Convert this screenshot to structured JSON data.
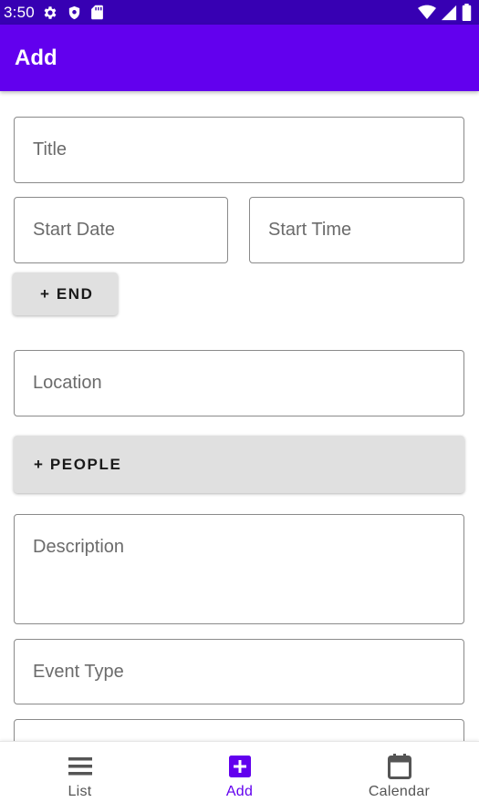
{
  "status_bar": {
    "time": "3:50",
    "left_icons": [
      "gear-icon",
      "shield-icon",
      "sd-card-icon"
    ],
    "right_icons": [
      "wifi-icon",
      "cell-signal-icon",
      "battery-icon"
    ]
  },
  "app_bar": {
    "title": "Add"
  },
  "form": {
    "title_placeholder": "Title",
    "start_date_placeholder": "Start Date",
    "start_time_placeholder": "Start Time",
    "end_button_label": "+ END",
    "location_placeholder": "Location",
    "people_button_label": "+ PEOPLE",
    "description_placeholder": "Description",
    "event_type_placeholder": "Event Type"
  },
  "bottom_nav": {
    "items": [
      {
        "label": "List",
        "icon": "list-icon",
        "active": false
      },
      {
        "label": "Add",
        "icon": "add-box-icon",
        "active": true
      },
      {
        "label": "Calendar",
        "icon": "calendar-icon",
        "active": false
      }
    ]
  },
  "colors": {
    "status_bar": "#3700b3",
    "primary": "#6200ee",
    "button_bg": "#e0e0e0",
    "field_border": "#8a8a8a",
    "inactive_nav": "#555555"
  }
}
